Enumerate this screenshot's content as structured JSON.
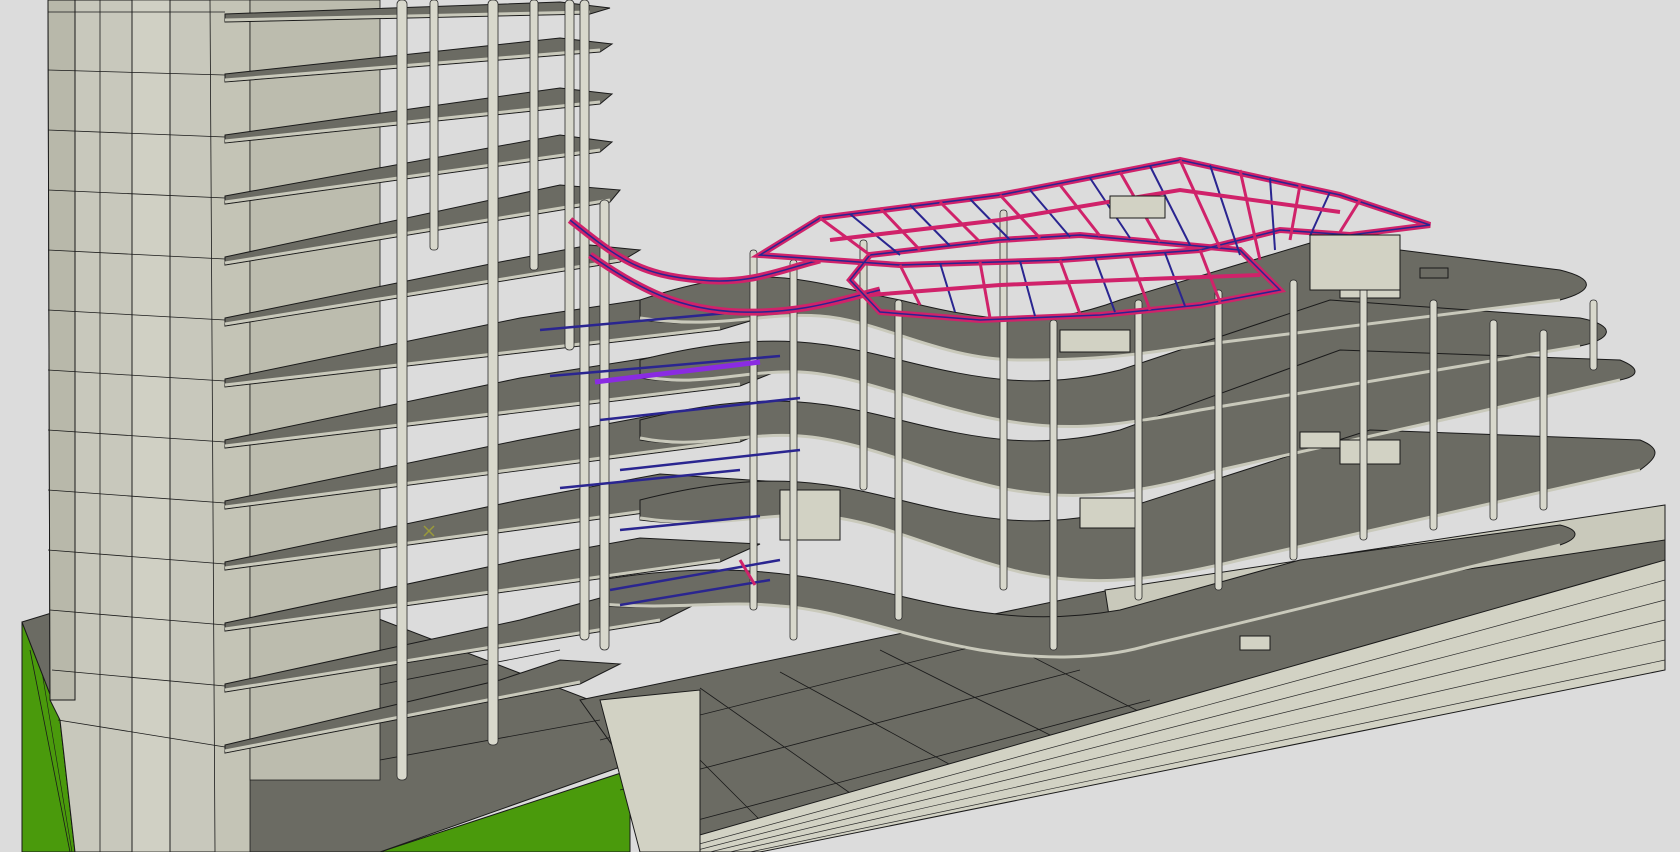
{
  "viewport": {
    "background": "#dcdcdc",
    "render_mode": "shaded-with-edges",
    "projection": "perspective"
  },
  "model": {
    "elements": [
      {
        "name": "tower-core",
        "kind": "concrete-core"
      },
      {
        "name": "floor-slabs",
        "kind": "slab"
      },
      {
        "name": "columns",
        "kind": "column"
      },
      {
        "name": "roof-truss",
        "kind": "steel-truss"
      },
      {
        "name": "podium-deck",
        "kind": "slab"
      },
      {
        "name": "base-wall",
        "kind": "facade-wall"
      },
      {
        "name": "green-zone",
        "kind": "landscape"
      }
    ],
    "colors": {
      "slab_top": "#6b6b63",
      "slab_edge": "#c9c9bb",
      "core": "#c8c8bc",
      "column": "#d8d8cc",
      "truss_primary": "#d0226a",
      "truss_secondary": "#2a2590",
      "highlight_beam": "#8a2be2",
      "green": "#4a9a0c",
      "line": "#1a1a1a"
    }
  },
  "cursor": {
    "icon": "snap-cross-icon",
    "color": "#9a9a3a"
  }
}
